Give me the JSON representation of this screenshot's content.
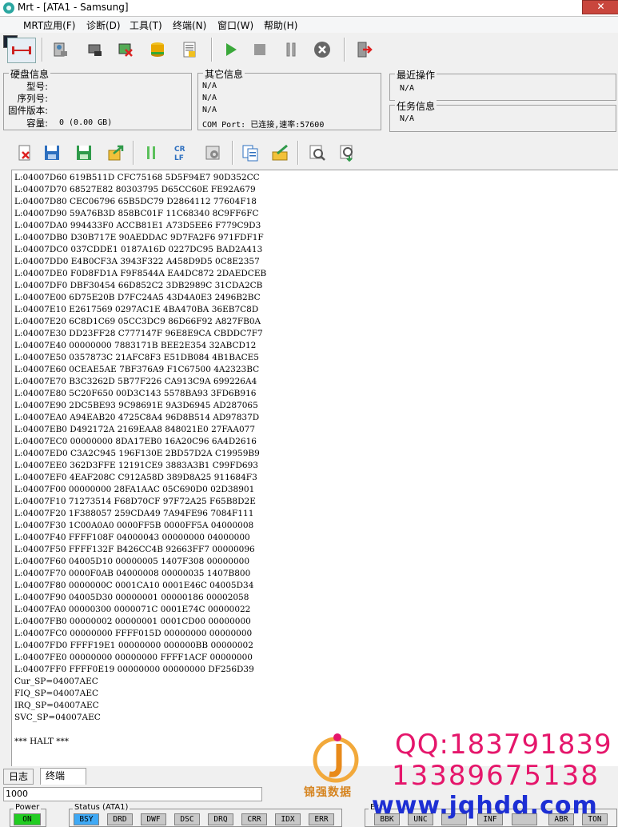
{
  "window": {
    "title": "Mrt - [ATA1 - Samsung]",
    "close_glyph": "✕"
  },
  "menu": [
    "MRT应用(F)",
    "诊断(D)",
    "工具(T)",
    "终端(N)",
    "窗口(W)",
    "帮助(H)"
  ],
  "disk_info": {
    "title": "硬盘信息",
    "labels": [
      "型号:",
      "序列号:",
      "固件版本:",
      "容量:"
    ],
    "capacity_value": "0 (0.00 GB)"
  },
  "other_info": {
    "title": "其它信息",
    "lines": [
      "N/A",
      "N/A",
      "N/A",
      "COM Port: 已连接,速率:57600"
    ]
  },
  "recent_op": {
    "title": "最近操作",
    "value": "N/A"
  },
  "task_info": {
    "title": "任务信息",
    "value": "N/A"
  },
  "toolbar2": {
    "crlf_label": "CR\nLF"
  },
  "terminal": {
    "lines": [
      "L:04007D60 619B511D CFC75168 5D5F94E7 90D352CC",
      "L:04007D70 68527E82 80303795 D65CC60E FE92A679",
      "L:04007D80 CEC06796 65B5DC79 D2864112 77604F18",
      "L:04007D90 59A76B3D 858BC01F 11C68340 8C9FF6FC",
      "L:04007DA0 994433F0 ACCB81E1 A73D5EE6 F779C9D3",
      "L:04007DB0 D30B717E 90AEDDAC 9D7FA2F6 971FDF1F",
      "L:04007DC0 037CDDE1 0187A16D 0227DC95 BAD2A413",
      "L:04007DD0 E4B0CF3A 3943F322 A458D9D5 0C8E2357",
      "L:04007DE0 F0D8FD1A F9F8544A EA4DC872 2DAEDCEB",
      "L:04007DF0 DBF30454 66D852C2 3DB2989C 31CDA2CB",
      "L:04007E00 6D75E20B D7FC24A5 43D4A0E3 2496B2BC",
      "L:04007E10 E2617569 0297AC1E 4BA470BA 36EB7C8D",
      "L:04007E20 6C8D1C69 05CC3DC9 86D66F92 A827FB0A",
      "L:04007E30 DD23FF28 C777147F 96E8E9CA CBDDC7F7",
      "L:04007E40 00000000 7883171B BEE2E354 32ABCD12",
      "L:04007E50 0357873C 21AFC8F3 E51DB084 4B1BACE5",
      "L:04007E60 0CEAE5AE 7BF376A9 F1C67500 4A2323BC",
      "L:04007E70 B3C3262D 5B77F226 CA913C9A 699226A4",
      "L:04007E80 5C20F650 00D3C143 5578BA93 3FD6B916",
      "L:04007E90 2DC5BE93 9C98691E 9A3D6945 AD287065",
      "L:04007EA0 A94EAB20 4725C8A4 96D8B514 AD97837D",
      "L:04007EB0 D492172A 2169EAA8 848021E0 27FAA077",
      "L:04007EC0 00000000 8DA17EB0 16A20C96 6A4D2616",
      "L:04007ED0 C3A2C945 196F130E 2BD57D2A C19959B9",
      "L:04007EE0 362D3FFE 12191CE9 3883A3B1 C99FD693",
      "L:04007EF0 4EAF208C C912A58D 389D8A25 911684F3",
      "L:04007F00 00000000 28FA1AAC 05C690D0 02D38901",
      "L:04007F10 71273514 F68D70CF 97F72A25 F65B8D2E",
      "L:04007F20 1F388057 259CDA49 7A94FE96 7084F111",
      "L:04007F30 1C00A0A0 0000FF5B 0000FF5A 04000008",
      "L:04007F40 FFFF108F 04000043 00000000 04000000",
      "L:04007F50 FFFF132F B426CC4B 92663FF7 00000096",
      "L:04007F60 04005D10 00000005 1407F308 00000000",
      "L:04007F70 0000F0AB 04000008 00000035 1407B800",
      "L:04007F80 0000000C 0001CA10 0001E46C 04005D34",
      "L:04007F90 04005D30 00000001 00000186 00002058",
      "L:04007FA0 00000300 0000071C 0001E74C 00000022",
      "L:04007FB0 00000002 00000001 0001CD00 00000000",
      "L:04007FC0 00000000 FFFF015D 00000000 00000000",
      "L:04007FD0 FFFF19E1 00000000 000000BB 00000002",
      "L:04007FE0 00000000 00000000 FFFF1ACF 00000000",
      "L:04007FF0 FFFF0E19 00000000 00000000 DF256D39",
      "Cur_SP=04007AEC",
      "FIQ_SP=04007AEC",
      "IRQ_SP=04007AEC",
      "SVC_SP=04007AEC",
      "",
      "*** HALT ***"
    ]
  },
  "tabs": {
    "log": "日志",
    "terminal": "终端"
  },
  "status_field": "1000",
  "power": {
    "title": "Power",
    "value": "ON"
  },
  "status": {
    "title": "Status (ATA1)",
    "flags": [
      "BSY",
      "DRD",
      "DWF",
      "DSC",
      "DRQ",
      "CRR",
      "IDX",
      "ERR"
    ]
  },
  "error": {
    "title": "Er",
    "flags": [
      "BBK",
      "UNC",
      "",
      "INF",
      "",
      "ABR",
      "TON"
    ]
  },
  "colors": {
    "power_on": "#22cc22",
    "bsy_active": "#3fa9f5",
    "watermark_pink": "#e5166b",
    "watermark_blue": "#1d2fd4"
  },
  "watermark": {
    "logo_text": "锦强数据",
    "qq": "QQ:183791839",
    "phone": "13389675138",
    "url": "www.jqhdd.com"
  },
  "icons": {
    "toolbar1": [
      "connect-icon",
      "disk-info-icon",
      "disk-tools-icon",
      "disk-delete-icon",
      "database-icon",
      "report-icon",
      "play-icon",
      "stop-icon",
      "pause-icon",
      "cancel-icon",
      "exit-icon"
    ],
    "toolbar2": [
      "clear-file-icon",
      "save-icon",
      "save-as-icon",
      "export-icon",
      "pause-icon",
      "crlf-icon",
      "settings-icon",
      "copy-icon",
      "edit-icon",
      "search-icon",
      "download-search-icon"
    ]
  }
}
